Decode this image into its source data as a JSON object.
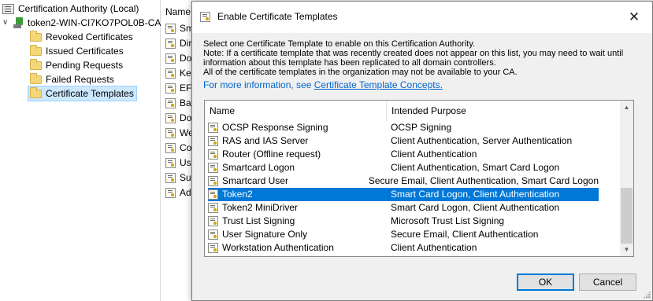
{
  "tree": {
    "root_label": "Certification Authority (Local)",
    "server_label": "token2-WIN-CI7KO7POL0B-CA",
    "children": [
      {
        "label": "Revoked Certificates"
      },
      {
        "label": "Issued Certificates"
      },
      {
        "label": "Pending Requests"
      },
      {
        "label": "Failed Requests"
      },
      {
        "label": "Certificate Templates"
      }
    ]
  },
  "background_list": {
    "header": "Name",
    "items": [
      "Sm",
      "Dir",
      "Do",
      "Ker",
      "EFS",
      "Bas",
      "Do",
      "We",
      "Co",
      "Use",
      "Sub",
      "Ad"
    ]
  },
  "dialog": {
    "title": "Enable Certificate Templates",
    "description_lines": [
      "Select one Certificate Template to enable on this Certification Authority.",
      "Note: If a certificate template that was recently created does not appear on this list, you may need to wait until",
      "information about this template has been replicated to all domain controllers.",
      "All of the certificate templates in the organization may not be available to your CA."
    ],
    "more_info_prefix": "For more information, see ",
    "more_info_link": "Certificate Template Concepts.",
    "columns": {
      "name": "Name",
      "purpose": "Intended Purpose"
    },
    "rows": [
      {
        "name": "OCSP Response Signing",
        "purpose": "OCSP Signing"
      },
      {
        "name": "RAS and IAS Server",
        "purpose": "Client Authentication, Server Authentication"
      },
      {
        "name": "Router (Offline request)",
        "purpose": "Client Authentication"
      },
      {
        "name": "Smartcard Logon",
        "purpose": "Client Authentication, Smart Card Logon"
      },
      {
        "name": "Smartcard User",
        "purpose": "Secure Email, Client Authentication, Smart Card Logon"
      },
      {
        "name": "Token2",
        "purpose": "Smart Card Logon, Client Authentication",
        "selected": true
      },
      {
        "name": "Token2 MiniDriver",
        "purpose": "Smart Card Logon, Client Authentication"
      },
      {
        "name": "Trust List Signing",
        "purpose": "Microsoft Trust List Signing"
      },
      {
        "name": "User Signature Only",
        "purpose": "Secure Email, Client Authentication"
      },
      {
        "name": "Workstation Authentication",
        "purpose": "Client Authentication"
      }
    ],
    "ok_label": "OK",
    "cancel_label": "Cancel",
    "close_glyph": "✕"
  },
  "colors": {
    "selection": "#0078d7",
    "link": "#0066cc",
    "tree_selection": "#cce8ff"
  },
  "icons": [
    "ca-icon",
    "server-icon",
    "folder-icon",
    "certificate-template-icon",
    "close-icon",
    "scroll-up-icon",
    "scroll-down-icon"
  ]
}
